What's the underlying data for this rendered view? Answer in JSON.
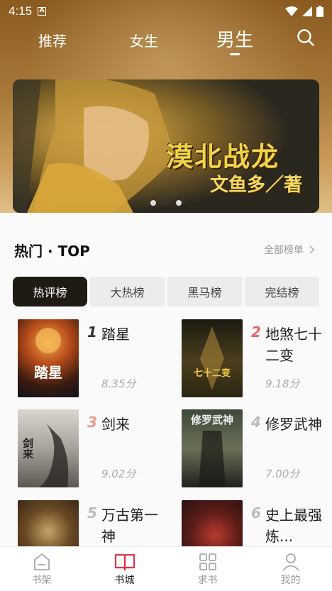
{
  "status_bar": {
    "time": "4:15",
    "notification_letter": "A"
  },
  "top_tabs": [
    {
      "label": "推荐",
      "active": false
    },
    {
      "label": "女生",
      "active": false
    },
    {
      "label": "男生",
      "active": true
    }
  ],
  "banner": {
    "title": "漠北战龙",
    "author": "文鱼多／著",
    "page_count": 3,
    "active_page": 2
  },
  "hot": {
    "title": "热门 · TOP",
    "view_all": "全部榜单",
    "tabs": [
      {
        "label": "热评榜",
        "active": true
      },
      {
        "label": "大热榜",
        "active": false
      },
      {
        "label": "黑马榜",
        "active": false
      },
      {
        "label": "完结榜",
        "active": false
      }
    ],
    "books": [
      {
        "rank": "1",
        "title": "踏星",
        "score": "8.35分",
        "cover_text": "踏星",
        "rank_color": "#333333"
      },
      {
        "rank": "2",
        "title": "地煞七十二变",
        "score": "9.18分",
        "cover_text": "七十二变",
        "rank_color": "#e8636a"
      },
      {
        "rank": "3",
        "title": "剑来",
        "score": "9.02分",
        "cover_text": "剑来",
        "rank_color": "#ef9a8a"
      },
      {
        "rank": "4",
        "title": "修罗武神",
        "score": "7.00分",
        "cover_text": "修罗武神",
        "rank_color": "#bbbbbb"
      },
      {
        "rank": "5",
        "title": "万古第一神",
        "score": "",
        "cover_text": "",
        "rank_color": "#bbbbbb"
      },
      {
        "rank": "6",
        "title": "史上最强炼...",
        "score": "",
        "cover_text": "",
        "rank_color": "#bbbbbb"
      }
    ]
  },
  "bottom_nav": [
    {
      "label": "书架",
      "icon": "bookshelf-icon",
      "active": false
    },
    {
      "label": "书城",
      "icon": "book-open-icon",
      "active": true
    },
    {
      "label": "求书",
      "icon": "grid-icon",
      "active": false
    },
    {
      "label": "我的",
      "icon": "user-icon",
      "active": false
    }
  ],
  "colors": {
    "accent": "#e0334a",
    "header_top": "#8a5a1e",
    "tab_active_bg": "#1f1a12"
  }
}
